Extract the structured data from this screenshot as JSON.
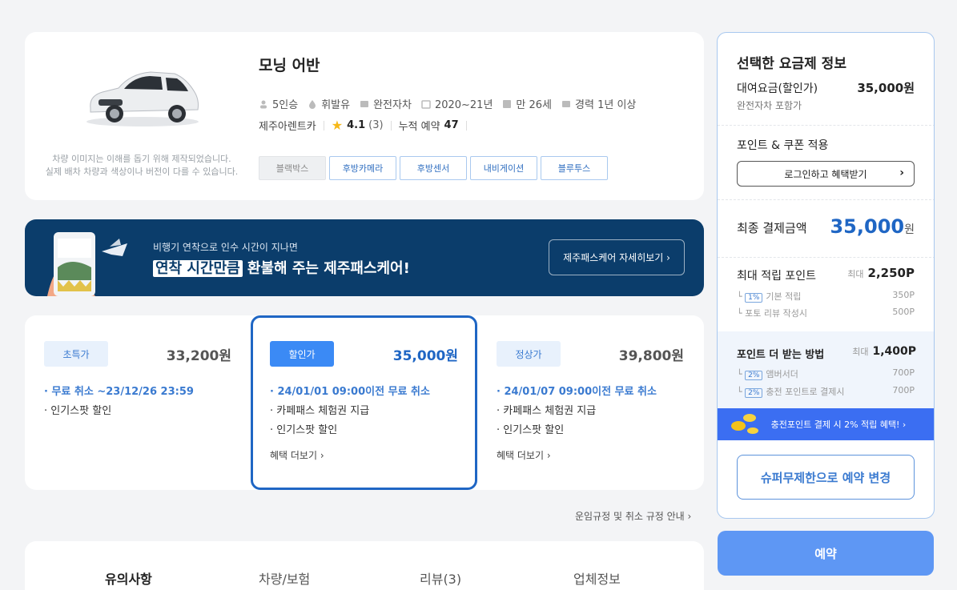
{
  "car": {
    "title": "모닝 어반",
    "note_line1": "차량 이미지는 이해를 돕기 위해 제작되었습니다.",
    "note_line2": "실제 배차 차량과 색상이나 버전이 다를 수 있습니다.",
    "specs": [
      "5인승",
      "휘발유",
      "완전자차",
      "2020~21년",
      "만 26세",
      "경력 1년 이상"
    ],
    "company": "제주아렌트카",
    "rating": "4.1",
    "review_count": "(3)",
    "bookings_label": "누적 예약",
    "bookings": "47",
    "tags": [
      "블랙박스",
      "후방카메라",
      "후방센서",
      "내비게이션",
      "블루투스"
    ]
  },
  "banner": {
    "sub": "비행기 연착으로 인수 시간이 지나면",
    "highlight": "연착 시간만큼",
    "main_rest": " 환불해 주는 제주패스케어!",
    "button": "제주패스케어 자세히보기 ›"
  },
  "plans": [
    {
      "badge": "초특가",
      "price": "33,200원",
      "lines": [
        "· 무료 취소 ~23/12/26 23:59",
        "· 인기스팟 할인"
      ],
      "more": ""
    },
    {
      "badge": "할인가",
      "price": "35,000원",
      "lines": [
        "· 24/01/01 09:00이전 무료 취소",
        "· 카페패스 체험권 지급",
        "· 인기스팟 할인"
      ],
      "more": "혜택 더보기 ›"
    },
    {
      "badge": "정상가",
      "price": "39,800원",
      "lines": [
        "· 24/01/07 09:00이전 무료 취소",
        "· 카페패스 체험권 지급",
        "· 인기스팟 할인"
      ],
      "more": "혜택 더보기 ›"
    }
  ],
  "rules_link": "운임규정 및 취소 규정 안내 ›",
  "tabs": [
    "유의사항",
    "차량/보험",
    "리뷰(3)",
    "업체정보"
  ],
  "panel": {
    "title": "선택한 요금제 정보",
    "rent_label": "대여요금(할인가)",
    "rent_value": "35,000원",
    "rent_sub": "완전자차 포함가",
    "coupon_label": "포인트 & 쿠폰 적용",
    "login_button": "로그인하고 혜택받기",
    "final_label": "최종 결제금액",
    "final_value": "35,000",
    "final_unit": "원",
    "max_point_label": "최대 적립 포인트",
    "max_prefix": "최대",
    "max_point_value": "2,250P",
    "basic_pct": "1%",
    "basic_label": "기본 적립",
    "basic_value": "350P",
    "photo_label": "포토 리뷰 작성시",
    "photo_value": "500P",
    "howto_label": "포인트 더 받는 방법",
    "howto_value": "1,400P",
    "amb_pct": "2%",
    "amb_label": "앰버서더",
    "amb_value": "700P",
    "charge_pct": "2%",
    "charge_label": "충전 포인트로 결제시",
    "charge_value": "700P",
    "charge_banner": "충전포인트 결제 시 2% 적립 혜택! ›",
    "super_button": "슈퍼무제한으로 예약 변경"
  },
  "reserve_button": "예약",
  "colors": {
    "accent": "#1f66c4",
    "banner_bg": "#0b3d6b",
    "reserve": "#5e97f4"
  }
}
